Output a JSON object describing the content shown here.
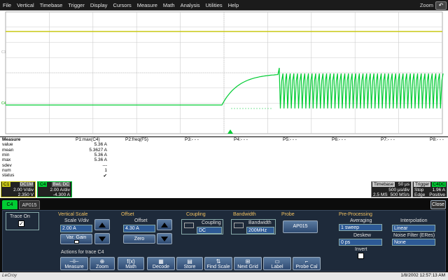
{
  "menu": [
    "File",
    "Vertical",
    "Timebase",
    "Trigger",
    "Display",
    "Cursors",
    "Measure",
    "Math",
    "Analysis",
    "Utilities",
    "Help"
  ],
  "zoom_label": "Zoom",
  "zoom_button_glyph": "↶",
  "colors": {
    "c1": "#c8c814",
    "c4": "#00cc33",
    "panel": "#1e2a3a",
    "field": "#2d5a96"
  },
  "grid_markers": {
    "c1_left": "C1",
    "c4_left": "C4"
  },
  "measure": {
    "headers": [
      "Measure",
      "P1:max(C4)",
      "P2:freq(F5)",
      "P3:- - -",
      "P4:- - -",
      "P5:- - -",
      "P6:- - -",
      "P7:- - -",
      "P8:- - -"
    ],
    "rows": [
      {
        "label": "value",
        "p1": "5.36 A"
      },
      {
        "label": "mean",
        "p1": "5.3627 A"
      },
      {
        "label": "min",
        "p1": "5.36 A"
      },
      {
        "label": "max",
        "p1": "5.36 A"
      },
      {
        "label": "sdev",
        "p1": "---"
      },
      {
        "label": "num",
        "p1": "1"
      },
      {
        "label": "status",
        "p1": "✔"
      }
    ]
  },
  "traces": {
    "c1": {
      "name": "C1",
      "mode": "DC1M",
      "vdiv": "2.00 V/div",
      "offset": "2.350 V"
    },
    "c4": {
      "name": "C4",
      "mode": "BwL DC",
      "vdiv": "2.00 A/div",
      "offset": "-4.300 A"
    }
  },
  "timebase": {
    "label": "Timebase",
    "value": "50 µs",
    "sample": "500 µs/div",
    "rate_left": "2.5 MS",
    "rate_right": "500 MS/s"
  },
  "trigger": {
    "label": "Trigger",
    "channel": "C4DC",
    "mode": "Stop",
    "level": "1.96 A",
    "type": "Edge",
    "slope": "Positive"
  },
  "bottom": {
    "tabs": [
      "C4",
      "AP015"
    ],
    "close": "Close",
    "trace_on": "Trace On",
    "vertical_scale": {
      "title": "Vertical Scale",
      "scale_label": "Scale V/div",
      "value": "2.00 A",
      "var_gain": "Var. Gain"
    },
    "offset": {
      "title": "Offset",
      "label": "Offset",
      "value": "4.30 A",
      "zero": "Zero"
    },
    "coupling": {
      "title": "Coupling",
      "label": "Coupling",
      "value": "DC"
    },
    "bandwidth": {
      "title": "Bandwidth",
      "label": "Bandwidth",
      "value": "200MHz"
    },
    "probe": {
      "title": "Probe",
      "value": "AP015"
    },
    "preproc": {
      "title": "Pre-Processing",
      "averaging": "Averaging",
      "averaging_value": "1 sweep",
      "deskew": "Deskew",
      "deskew_value": "0 ps",
      "invert": "Invert",
      "interpolation": "Interpolation",
      "interp_value": "Linear",
      "noise": "Noise Filter (ERes)",
      "noise_value": "None"
    },
    "actions_title": "Actions for trace C4",
    "actions": [
      {
        "label": "Measure",
        "icon": "⊣⊢"
      },
      {
        "label": "Zoom",
        "icon": "⊕"
      },
      {
        "label": "Math",
        "icon": "f(x)"
      },
      {
        "label": "Decode",
        "icon": "▦"
      },
      {
        "label": "Store",
        "icon": "▤"
      },
      {
        "label": "Find Scale",
        "icon": "⇅"
      },
      {
        "label": "Next Grid",
        "icon": "⊞"
      },
      {
        "label": "Label",
        "icon": "▭"
      },
      {
        "label": "Probe Cal",
        "icon": "⌐"
      }
    ]
  },
  "status": {
    "brand": "LeCroy",
    "datetime": "1/8/2002 12:57:13 AM"
  }
}
